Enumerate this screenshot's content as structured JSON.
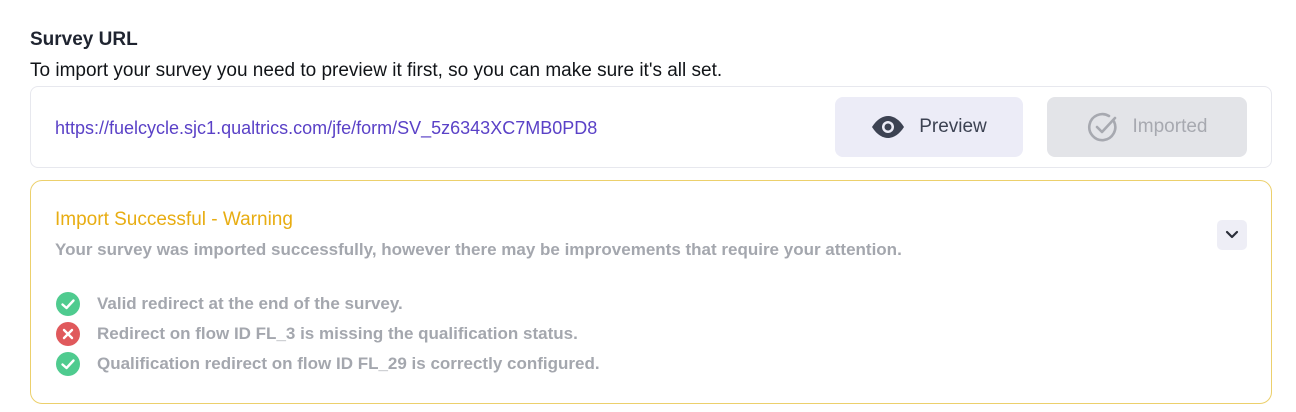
{
  "section": {
    "title": "Survey URL",
    "description": "To import your survey you need to preview it first, so you can make sure it's all set."
  },
  "url_box": {
    "url": "https://fuelcycle.sjc1.qualtrics.com/jfe/form/SV_5z6343XC7MB0PD8",
    "preview_label": "Preview",
    "imported_label": "Imported"
  },
  "warning": {
    "title": "Import Successful - Warning",
    "description": "Your survey was imported successfully, however there may be improvements that require your attention.",
    "checks": [
      {
        "status": "success",
        "icon": "check-circle-icon",
        "text": "Valid redirect at the end of the survey."
      },
      {
        "status": "error",
        "icon": "x-circle-icon",
        "text": "Redirect on flow ID FL_3 is missing the qualification status."
      },
      {
        "status": "success",
        "icon": "check-circle-icon",
        "text": "Qualification redirect on flow ID FL_29 is correctly configured."
      }
    ]
  },
  "colors": {
    "accent": "#5a41c7",
    "warning": "#e8ad12",
    "success": "#4fcb8f",
    "error": "#e0595c"
  }
}
